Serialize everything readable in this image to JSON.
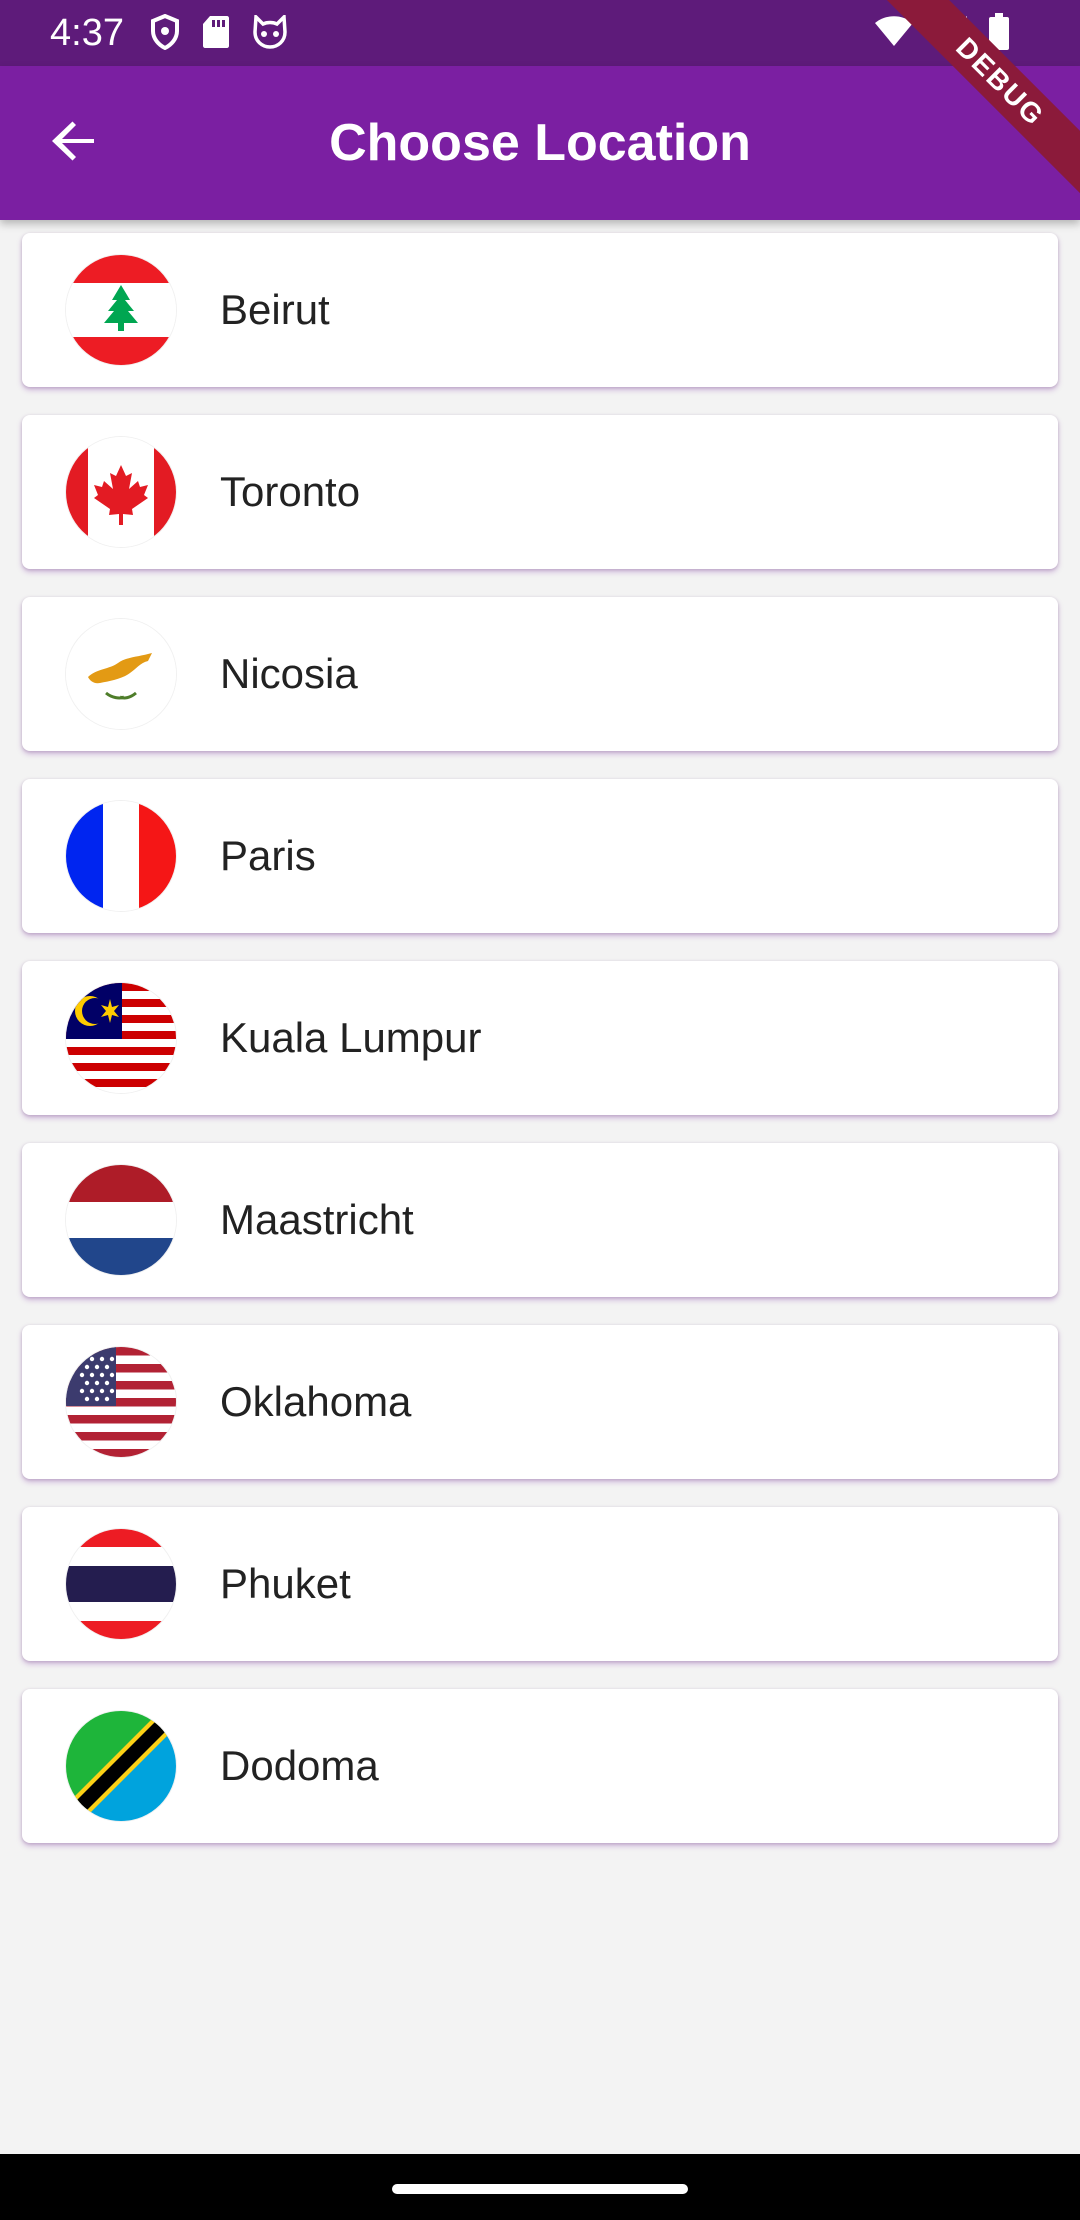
{
  "status_bar": {
    "time": "4:37",
    "left_icons": [
      "shield-icon",
      "sd-card-icon",
      "cat-face-icon"
    ],
    "right_icons": [
      "wifi-icon",
      "cell-signal-icon",
      "battery-icon"
    ]
  },
  "app_bar": {
    "title": "Choose Location",
    "back_icon": "arrow-back-icon",
    "background": "#7b1fa2"
  },
  "debug_banner": "DEBUG",
  "locations": [
    {
      "name": "Beirut",
      "flag": "lebanon-flag-icon"
    },
    {
      "name": "Toronto",
      "flag": "canada-flag-icon"
    },
    {
      "name": "Nicosia",
      "flag": "cyprus-flag-icon"
    },
    {
      "name": "Paris",
      "flag": "france-flag-icon"
    },
    {
      "name": "Kuala Lumpur",
      "flag": "malaysia-flag-icon"
    },
    {
      "name": "Maastricht",
      "flag": "netherlands-flag-icon"
    },
    {
      "name": "Oklahoma",
      "flag": "usa-flag-icon"
    },
    {
      "name": "Phuket",
      "flag": "thailand-flag-icon"
    },
    {
      "name": "Dodoma",
      "flag": "tanzania-flag-icon"
    }
  ]
}
